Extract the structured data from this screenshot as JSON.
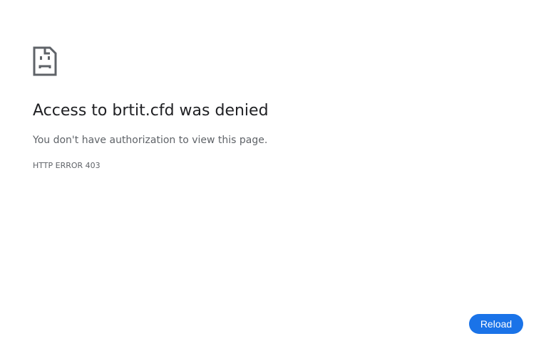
{
  "error": {
    "icon": "sad-page-icon",
    "title": "Access to brtit.cfd was denied",
    "message": "You don't have authorization to view this page.",
    "code": "HTTP ERROR 403"
  },
  "actions": {
    "reload_label": "Reload"
  },
  "colors": {
    "text_primary": "#202124",
    "text_secondary": "#5f6368",
    "icon": "#5f6368",
    "button_bg": "#1a73e8",
    "button_text": "#ffffff"
  }
}
